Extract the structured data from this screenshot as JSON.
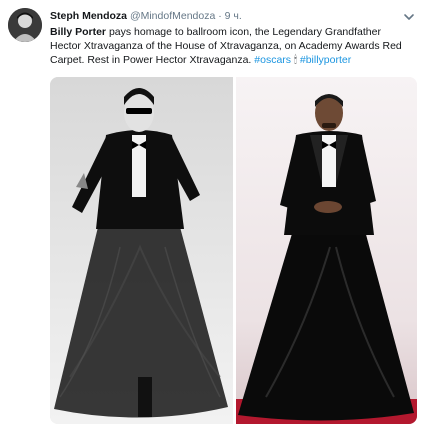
{
  "tweet": {
    "display_name": "Steph Mendoza",
    "handle": "@MindofMendoza",
    "separator": "·",
    "time": "9 ч.",
    "text_name": "Billy Porter",
    "text_body": " pays homage to ballroom icon, the Legendary Grandfather Hector Xtravaganza of the House of Xtravaganza, on Academy Awards Red Carpet. Rest in Power Hector Xtravaganza. ",
    "hashtag_oscars": "#oscars",
    "emoji": "🕯",
    "hashtag_billyporter": "#billyporter"
  },
  "icons": {
    "avatar": "user-avatar",
    "menu": "chevron-down-icon",
    "emoji": "candle-icon"
  },
  "colors": {
    "name": "#14171a",
    "muted": "#657786",
    "link": "#1b95e0",
    "carpet": "#b3182e"
  }
}
